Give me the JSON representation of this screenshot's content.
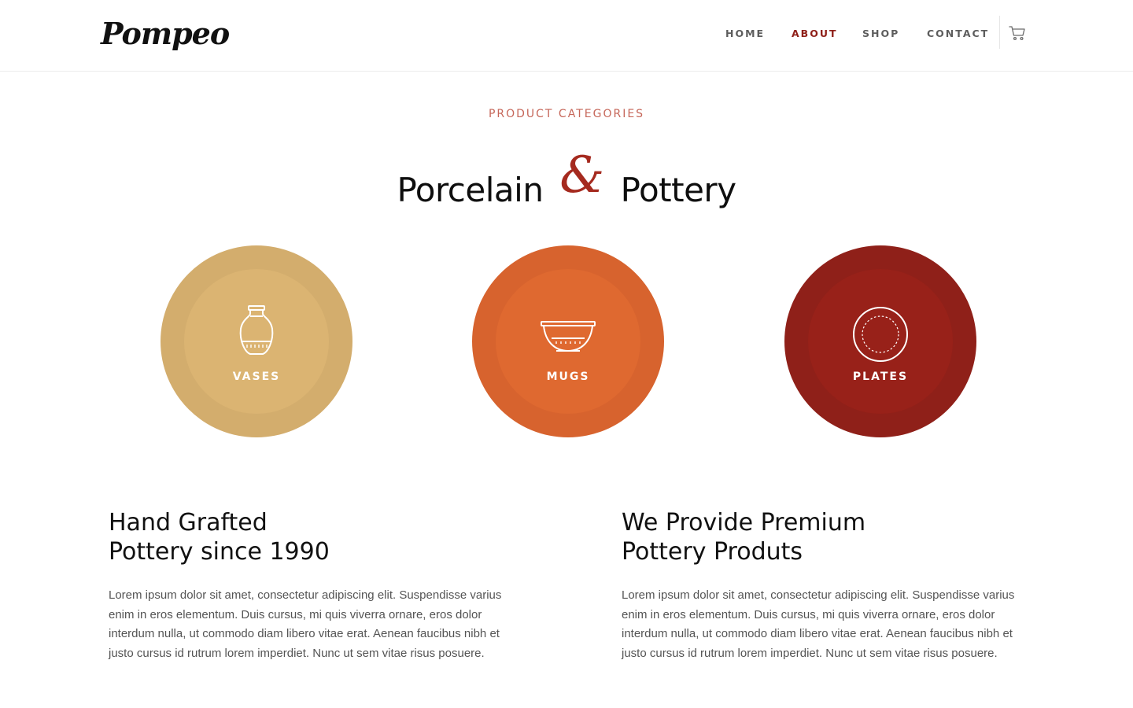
{
  "brand": {
    "logo_text": "Pompeo"
  },
  "nav": {
    "items": [
      {
        "label": "HOME",
        "active": false
      },
      {
        "label": "ABOUT",
        "active": true
      },
      {
        "label": "SHOP",
        "active": false
      },
      {
        "label": "CONTACT",
        "active": false
      }
    ],
    "cart_icon": "cart-icon"
  },
  "section": {
    "eyebrow": "PRODUCT CATEGORIES",
    "title_part1": "Porcelain",
    "title_amp": "&",
    "title_part2": "Pottery"
  },
  "categories": [
    {
      "label": "VASES",
      "icon": "vase-icon",
      "outer_color": "#d3ad6d",
      "inner_color": "#dbb472"
    },
    {
      "label": "MUGS",
      "icon": "bowl-icon",
      "outer_color": "#d7632e",
      "inner_color": "#df6930"
    },
    {
      "label": "PLATES",
      "icon": "plate-icon",
      "outer_color": "#8f2019",
      "inner_color": "#982119"
    }
  ],
  "content": {
    "left": {
      "title_line1": "Hand Grafted",
      "title_line2": "Pottery since 1990",
      "body": "Lorem ipsum dolor sit amet, consectetur adipiscing elit. Suspendisse varius enim in eros elementum. Duis cursus, mi quis viverra ornare, eros dolor interdum nulla, ut commodo diam libero vitae erat. Aenean faucibus nibh et justo cursus id rutrum lorem imperdiet. Nunc ut sem vitae risus posuere."
    },
    "right": {
      "title_line1": "We Provide Premium",
      "title_line2": "Pottery Produts",
      "body": "Lorem ipsum dolor sit amet, consectetur adipiscing elit. Suspendisse varius enim in eros elementum. Duis cursus, mi quis viverra ornare, eros dolor interdum nulla, ut commodo diam libero vitae erat. Aenean faucibus nibh et justo cursus id rutrum lorem imperdiet. Nunc ut sem vitae risus posuere."
    }
  },
  "colors": {
    "accent": "#8f2019",
    "eyebrow": "#c6675a",
    "ampersand": "#a52a1f"
  }
}
